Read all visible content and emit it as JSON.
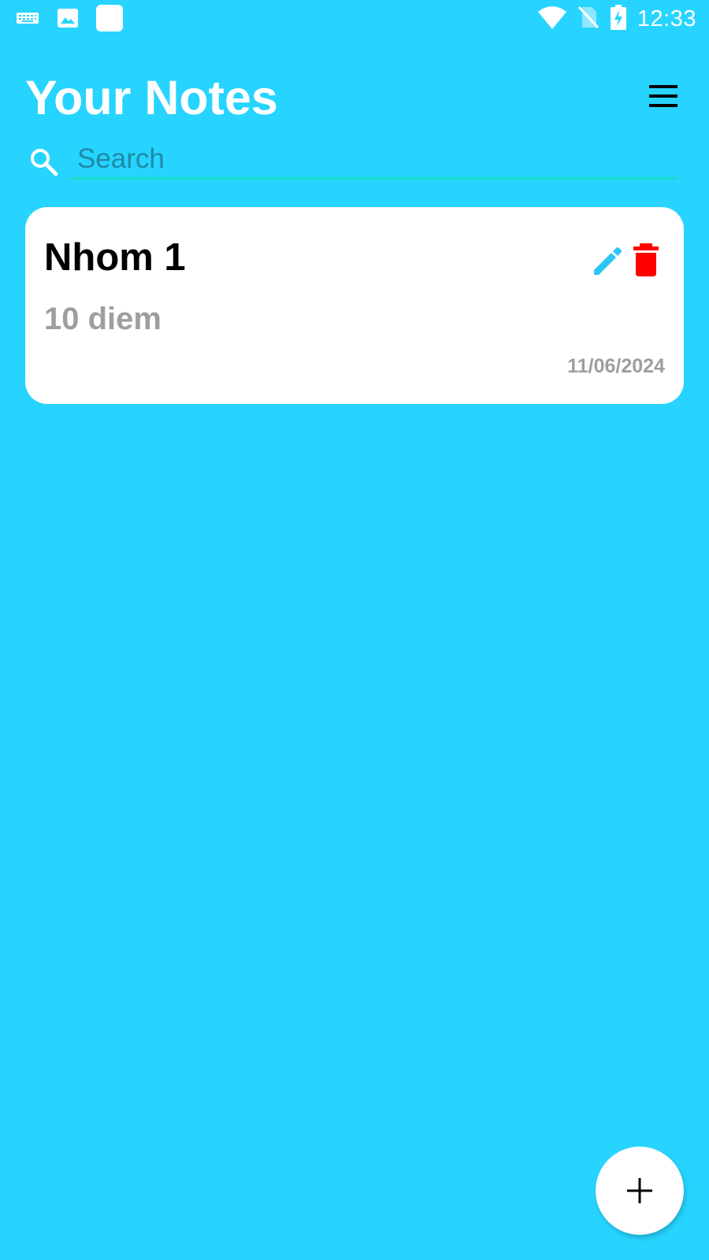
{
  "status_bar": {
    "time": "12:33",
    "left_icons": [
      "keyboard-icon",
      "image-icon",
      "app-square-icon"
    ],
    "right_icons": [
      "wifi-icon",
      "no-sim-icon",
      "battery-charging-icon"
    ]
  },
  "header": {
    "title": "Your Notes",
    "menu_icon": "hamburger-menu-icon"
  },
  "search": {
    "placeholder": "Search",
    "value": "",
    "icon": "search-icon"
  },
  "notes": [
    {
      "title": "Nhom 1",
      "content": "10 diem",
      "date": "11/06/2024",
      "actions": [
        "edit-icon",
        "delete-icon"
      ]
    }
  ],
  "fab": {
    "icon": "plus-icon"
  },
  "colors": {
    "background": "#26d4ff",
    "card": "#ffffff",
    "edit_icon": "#29c6f6",
    "delete_icon": "#ff0000",
    "search_underline": "#16dcc2",
    "muted_text": "#9e9e9e"
  }
}
